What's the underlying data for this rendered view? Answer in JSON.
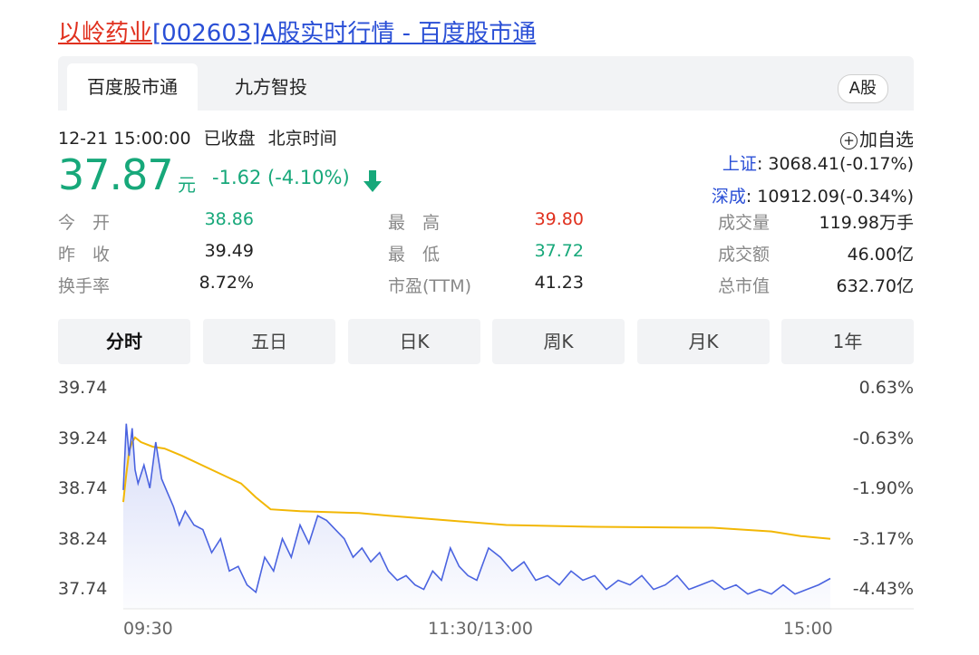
{
  "page_title": {
    "name": "以岭药业",
    "rest": "[002603]A股实时行情 - 百度股市通"
  },
  "tabs": [
    "百度股市通",
    "九方智投"
  ],
  "market_badge": "A股",
  "quote": {
    "datetime": "12-21 15:00:00",
    "status": "已收盘",
    "timezone": "北京时间",
    "price": "37.87",
    "unit": "元",
    "change": "-1.62 (-4.10%)",
    "add_watch": "加自选"
  },
  "indices": [
    {
      "name": "上证",
      "value": ": 3068.41(-0.17%)"
    },
    {
      "name": "深成",
      "value": ": 10912.09(-0.34%)"
    }
  ],
  "stats": [
    [
      {
        "label": "今　开",
        "value": "38.86",
        "tone": "green"
      },
      {
        "label": "最　高",
        "value": "39.80",
        "tone": "red"
      },
      {
        "label": "成交量",
        "value": "119.98万手",
        "tone": "dark"
      }
    ],
    [
      {
        "label": "昨　收",
        "value": "39.49",
        "tone": "dark"
      },
      {
        "label": "最　低",
        "value": "37.72",
        "tone": "green"
      },
      {
        "label": "成交额",
        "value": "46.00亿",
        "tone": "dark"
      }
    ],
    [
      {
        "label": "换手率",
        "value": "8.72%",
        "tone": "dark"
      },
      {
        "label": "市盈(TTM)",
        "value": "41.23",
        "tone": "dark"
      },
      {
        "label": "总市值",
        "value": "632.70亿",
        "tone": "dark"
      }
    ]
  ],
  "ranges": [
    "分时",
    "五日",
    "日K",
    "周K",
    "月K",
    "1年"
  ],
  "active_range": 0,
  "colors": {
    "price_line": "#4a63e0",
    "avg_line": "#f2b705",
    "green": "#17a87a",
    "red": "#e0301e"
  },
  "chart_data": {
    "type": "line",
    "x_tick_labels": [
      "09:30",
      "11:30/13:00",
      "15:00"
    ],
    "y_tick_labels": [
      "39.74",
      "39.24",
      "38.74",
      "38.24",
      "37.74"
    ],
    "y2_tick_labels": [
      "0.63%",
      "-0.63%",
      "-1.90%",
      "-3.17%",
      "-4.43%"
    ],
    "ylim": [
      37.54,
      39.94
    ],
    "x_range": [
      0,
      240
    ],
    "series": [
      {
        "role": "price",
        "x": [
          0,
          1,
          2,
          3,
          4,
          5,
          7,
          9,
          11,
          13,
          15,
          17,
          19,
          21,
          24,
          27,
          30,
          33,
          36,
          39,
          42,
          45,
          48,
          51,
          54,
          57,
          60,
          63,
          66,
          69,
          72,
          75,
          78,
          81,
          84,
          87,
          90,
          93,
          96,
          99,
          102,
          105,
          108,
          111,
          114,
          117,
          120,
          124,
          128,
          132,
          136,
          140,
          144,
          148,
          152,
          156,
          160,
          164,
          168,
          172,
          176,
          180,
          184,
          188,
          192,
          196,
          200,
          204,
          208,
          212,
          216,
          220,
          224,
          228,
          232,
          236,
          240
        ],
        "values": [
          38.83,
          39.55,
          39.2,
          39.5,
          39.05,
          38.9,
          39.1,
          38.85,
          39.35,
          38.95,
          38.8,
          38.65,
          38.45,
          38.6,
          38.45,
          38.4,
          38.15,
          38.3,
          37.95,
          38.0,
          37.8,
          37.72,
          38.1,
          37.95,
          38.3,
          38.1,
          38.45,
          38.25,
          38.55,
          38.5,
          38.4,
          38.3,
          38.1,
          38.2,
          38.05,
          38.15,
          37.95,
          37.85,
          37.9,
          37.8,
          37.75,
          37.95,
          37.85,
          38.2,
          38.0,
          37.9,
          37.85,
          38.2,
          38.1,
          37.95,
          38.05,
          37.85,
          37.9,
          37.8,
          37.95,
          37.85,
          37.9,
          37.75,
          37.85,
          37.8,
          37.9,
          37.75,
          37.8,
          37.9,
          37.75,
          37.8,
          37.85,
          37.75,
          37.8,
          37.7,
          37.75,
          37.7,
          37.8,
          37.7,
          37.75,
          37.8,
          37.87
        ]
      },
      {
        "role": "average",
        "x": [
          0,
          1,
          2,
          3,
          4,
          6,
          10,
          14,
          20,
          30,
          40,
          45,
          50,
          60,
          80,
          90,
          110,
          130,
          160,
          200,
          220,
          230,
          240
        ],
        "values": [
          38.7,
          39.0,
          39.25,
          39.35,
          39.4,
          39.35,
          39.3,
          39.28,
          39.2,
          39.05,
          38.9,
          38.75,
          38.62,
          38.6,
          38.58,
          38.55,
          38.5,
          38.45,
          38.43,
          38.42,
          38.38,
          38.33,
          38.3
        ]
      }
    ]
  }
}
